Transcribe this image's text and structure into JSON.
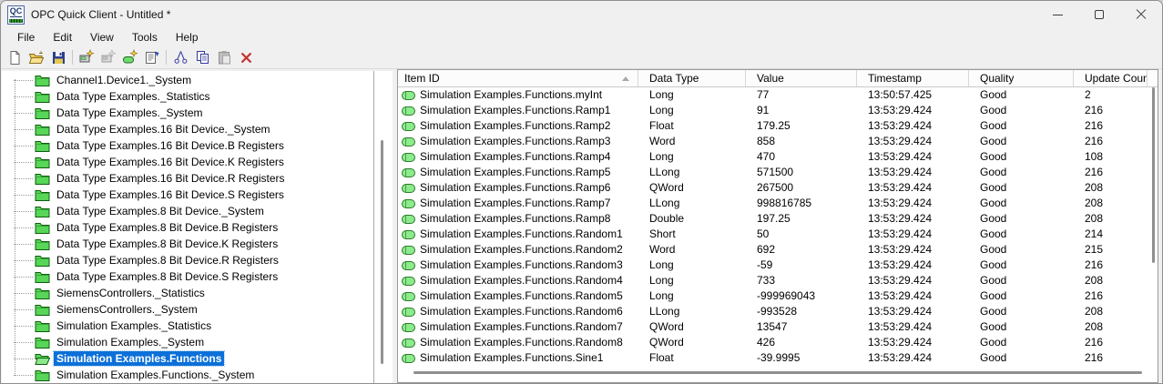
{
  "window": {
    "title": "OPC Quick Client - Untitled *",
    "icon_label": "QC",
    "controls": [
      "minimize-icon",
      "maximize-icon",
      "close-icon"
    ]
  },
  "menu": {
    "items": [
      "File",
      "Edit",
      "View",
      "Tools",
      "Help"
    ]
  },
  "toolbar": {
    "buttons": [
      {
        "icon": "new-file-icon",
        "enabled": true
      },
      {
        "icon": "open-file-icon",
        "enabled": true
      },
      {
        "icon": "save-file-icon",
        "enabled": true
      },
      {
        "icon": "new-server-connection-icon",
        "enabled": true
      },
      {
        "icon": "new-group-icon",
        "enabled": false
      },
      {
        "icon": "new-item-icon",
        "enabled": true
      },
      {
        "icon": "properties-icon",
        "enabled": true
      },
      {
        "icon": "cut-icon",
        "enabled": true
      },
      {
        "icon": "copy-icon",
        "enabled": true
      },
      {
        "icon": "paste-icon",
        "enabled": false
      },
      {
        "icon": "delete-icon",
        "enabled": true
      }
    ]
  },
  "tree": {
    "items": [
      {
        "label": "Channel1.Device1._System"
      },
      {
        "label": "Data Type Examples._Statistics"
      },
      {
        "label": "Data Type Examples._System"
      },
      {
        "label": "Data Type Examples.16 Bit Device._System"
      },
      {
        "label": "Data Type Examples.16 Bit Device.B Registers"
      },
      {
        "label": "Data Type Examples.16 Bit Device.K Registers"
      },
      {
        "label": "Data Type Examples.16 Bit Device.R Registers"
      },
      {
        "label": "Data Type Examples.16 Bit Device.S Registers"
      },
      {
        "label": "Data Type Examples.8 Bit Device._System"
      },
      {
        "label": "Data Type Examples.8 Bit Device.B Registers"
      },
      {
        "label": "Data Type Examples.8 Bit Device.K Registers"
      },
      {
        "label": "Data Type Examples.8 Bit Device.R Registers"
      },
      {
        "label": "Data Type Examples.8 Bit Device.S Registers"
      },
      {
        "label": "SiemensControllers._Statistics"
      },
      {
        "label": "SiemensControllers._System"
      },
      {
        "label": "Simulation Examples._Statistics"
      },
      {
        "label": "Simulation Examples._System"
      },
      {
        "label": "Simulation Examples.Functions",
        "selected": true
      },
      {
        "label": "Simulation Examples.Functions._System"
      }
    ]
  },
  "list": {
    "columns": [
      {
        "label": "Item ID",
        "sorted": "ascending"
      },
      {
        "label": "Data Type"
      },
      {
        "label": "Value"
      },
      {
        "label": "Timestamp"
      },
      {
        "label": "Quality"
      },
      {
        "label": "Update Count"
      }
    ],
    "rows": [
      {
        "item_id": "Simulation Examples.Functions.myInt",
        "data_type": "Long",
        "value": "77",
        "timestamp": "13:50:57.425",
        "quality": "Good",
        "update_count": "2"
      },
      {
        "item_id": "Simulation Examples.Functions.Ramp1",
        "data_type": "Long",
        "value": "91",
        "timestamp": "13:53:29.424",
        "quality": "Good",
        "update_count": "216"
      },
      {
        "item_id": "Simulation Examples.Functions.Ramp2",
        "data_type": "Float",
        "value": "179.25",
        "timestamp": "13:53:29.424",
        "quality": "Good",
        "update_count": "216"
      },
      {
        "item_id": "Simulation Examples.Functions.Ramp3",
        "data_type": "Word",
        "value": "858",
        "timestamp": "13:53:29.424",
        "quality": "Good",
        "update_count": "216"
      },
      {
        "item_id": "Simulation Examples.Functions.Ramp4",
        "data_type": "Long",
        "value": "470",
        "timestamp": "13:53:29.424",
        "quality": "Good",
        "update_count": "108"
      },
      {
        "item_id": "Simulation Examples.Functions.Ramp5",
        "data_type": "LLong",
        "value": "571500",
        "timestamp": "13:53:29.424",
        "quality": "Good",
        "update_count": "216"
      },
      {
        "item_id": "Simulation Examples.Functions.Ramp6",
        "data_type": "QWord",
        "value": "267500",
        "timestamp": "13:53:29.424",
        "quality": "Good",
        "update_count": "208"
      },
      {
        "item_id": "Simulation Examples.Functions.Ramp7",
        "data_type": "LLong",
        "value": "998816785",
        "timestamp": "13:53:29.424",
        "quality": "Good",
        "update_count": "208"
      },
      {
        "item_id": "Simulation Examples.Functions.Ramp8",
        "data_type": "Double",
        "value": "197.25",
        "timestamp": "13:53:29.424",
        "quality": "Good",
        "update_count": "208"
      },
      {
        "item_id": "Simulation Examples.Functions.Random1",
        "data_type": "Short",
        "value": "50",
        "timestamp": "13:53:29.424",
        "quality": "Good",
        "update_count": "214"
      },
      {
        "item_id": "Simulation Examples.Functions.Random2",
        "data_type": "Word",
        "value": "692",
        "timestamp": "13:53:29.424",
        "quality": "Good",
        "update_count": "215"
      },
      {
        "item_id": "Simulation Examples.Functions.Random3",
        "data_type": "Long",
        "value": "-59",
        "timestamp": "13:53:29.424",
        "quality": "Good",
        "update_count": "216"
      },
      {
        "item_id": "Simulation Examples.Functions.Random4",
        "data_type": "Long",
        "value": "733",
        "timestamp": "13:53:29.424",
        "quality": "Good",
        "update_count": "208"
      },
      {
        "item_id": "Simulation Examples.Functions.Random5",
        "data_type": "Long",
        "value": "-999969043",
        "timestamp": "13:53:29.424",
        "quality": "Good",
        "update_count": "216"
      },
      {
        "item_id": "Simulation Examples.Functions.Random6",
        "data_type": "LLong",
        "value": "-993528",
        "timestamp": "13:53:29.424",
        "quality": "Good",
        "update_count": "208"
      },
      {
        "item_id": "Simulation Examples.Functions.Random7",
        "data_type": "QWord",
        "value": "13547",
        "timestamp": "13:53:29.424",
        "quality": "Good",
        "update_count": "208"
      },
      {
        "item_id": "Simulation Examples.Functions.Random8",
        "data_type": "QWord",
        "value": "426",
        "timestamp": "13:53:29.424",
        "quality": "Good",
        "update_count": "216"
      },
      {
        "item_id": "Simulation Examples.Functions.Sine1",
        "data_type": "Float",
        "value": "-39.9995",
        "timestamp": "13:53:29.424",
        "quality": "Good",
        "update_count": "216"
      }
    ]
  },
  "colors": {
    "selection_blue": "#0c70d8",
    "folder_green": "#57d657",
    "item_tag_green": "#8ceb8c",
    "delete_red": "#c3312f"
  }
}
